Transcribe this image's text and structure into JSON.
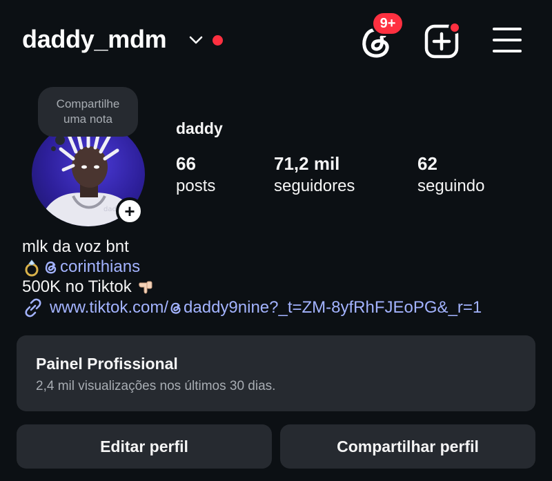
{
  "header": {
    "username": "daddy_mdm",
    "notification_badge": "9+"
  },
  "note": {
    "placeholder_line1": "Compartilhe",
    "placeholder_line2": "uma nota"
  },
  "avatar": {
    "watermark_text": "dad"
  },
  "profile": {
    "display_name": "daddy",
    "stats": [
      {
        "value": "66",
        "label": "posts"
      },
      {
        "value": "71,2 mil",
        "label": "seguidores"
      },
      {
        "value": "62",
        "label": "seguindo"
      }
    ]
  },
  "bio": {
    "line1": "mlk da voz bnt",
    "mention": "corinthians",
    "line3": "500K no Tiktok",
    "link_prefix": "www.tiktok.com/",
    "link_suffix": "daddy9nine?_t=ZM-8yfRhFJEoPG&_r=1"
  },
  "dashboard": {
    "title": "Painel Profissional",
    "subtitle": "2,4 mil visualizações nos últimos 30 dias."
  },
  "buttons": {
    "edit": "Editar perfil",
    "share": "Compartilhar perfil"
  },
  "colors": {
    "background": "#0c1014",
    "surface": "#262a30",
    "accent_link": "#a3b3ff",
    "notification": "#ff3040"
  },
  "icons": {
    "threads": "threads-icon",
    "create": "plus-square-icon",
    "menu": "hamburger-menu-icon",
    "dropdown": "chevron-down-icon",
    "link": "link-icon",
    "ring": "ring-emoji-icon",
    "pointing": "pointing-down-emoji-icon"
  }
}
